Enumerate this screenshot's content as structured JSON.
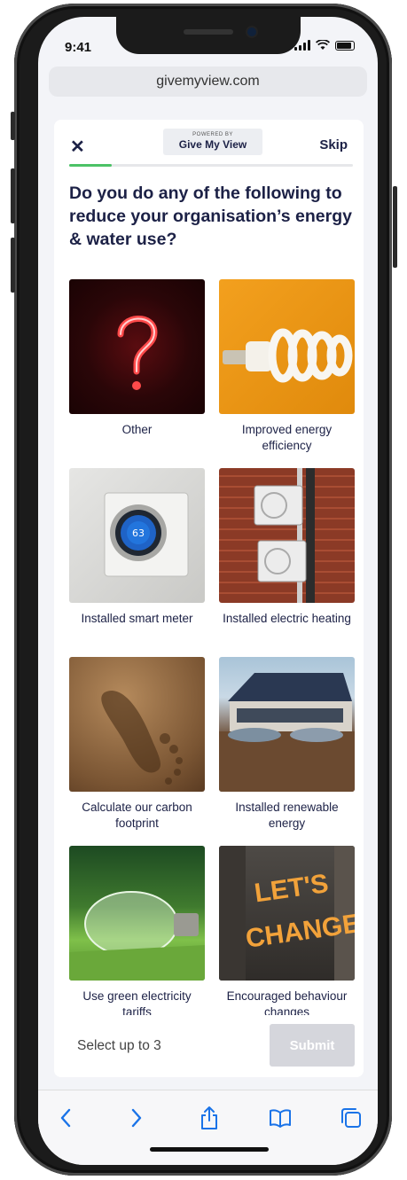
{
  "status_bar": {
    "time": "9:41"
  },
  "browser": {
    "url": "givemyview.com"
  },
  "header": {
    "close_label": "✕",
    "logo_powered": "POWERED BY",
    "logo_brand": "Give My View",
    "skip_label": "Skip",
    "progress": 0.15
  },
  "question": "Do you do any of the following to reduce your organisation’s energy & water use?",
  "options": [
    {
      "label": "Other",
      "image": "red-question-mark-neon"
    },
    {
      "label": "Improved energy efficiency",
      "image": "energy-saving-bulb"
    },
    {
      "label": "Installed smart meter",
      "image": "smart-thermostat"
    },
    {
      "label": "Installed electric heating",
      "image": "air-conditioning-units"
    },
    {
      "label": "Calculate our carbon footprint",
      "image": "footprint-in-sand"
    },
    {
      "label": "Installed renewable energy",
      "image": "solar-panel-roof"
    },
    {
      "label": "Use green electricity tariffs",
      "image": "bulb-on-grass"
    },
    {
      "label": "Encouraged behaviour changes",
      "image": "lets-change-sign"
    }
  ],
  "footer": {
    "hint": "Select up to 3",
    "submit_label": "Submit"
  },
  "colors": {
    "navy": "#1c2146",
    "progress": "#4cc266",
    "submit_disabled": "#d5d6dc",
    "ios_blue": "#1a73e8"
  }
}
